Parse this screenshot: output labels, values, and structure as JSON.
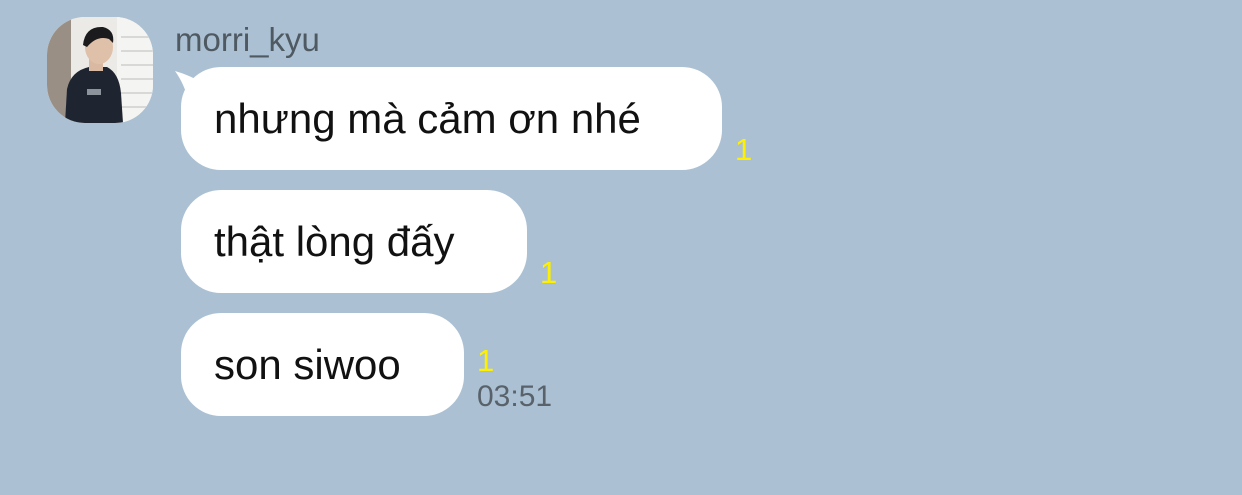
{
  "chat": {
    "sender_name": "morri_kyu",
    "messages": [
      {
        "text": "nhưng mà cảm ơn nhé",
        "unread": "1"
      },
      {
        "text": "thật lòng đấy",
        "unread": "1"
      },
      {
        "text": "son siwoo",
        "unread": "1",
        "time": "03:51"
      }
    ]
  },
  "colors": {
    "background": "#abc1d3",
    "bubble": "#ffffff",
    "unread_count": "#fff000",
    "meta_text": "#59626b"
  },
  "icons": {
    "avatar": "profile-photo"
  }
}
